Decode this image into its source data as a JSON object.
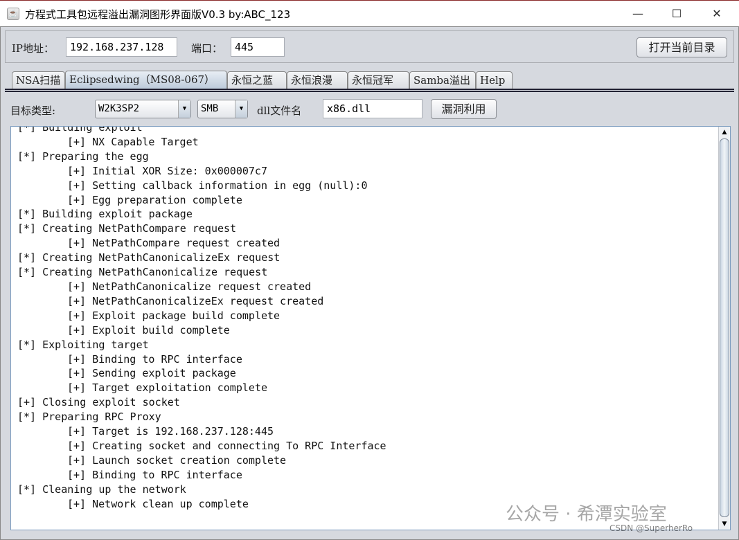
{
  "window": {
    "title": "方程式工具包远程溢出漏洞图形界面版V0.3 by:ABC_123",
    "minimize": "—",
    "maximize": "☐",
    "close": "✕"
  },
  "connection": {
    "ip_label": "IP地址：",
    "ip_value": "192.168.237.128",
    "port_label": "端口：",
    "port_value": "445",
    "open_dir_button": "打开当前目录"
  },
  "tabs": [
    {
      "label": "NSA扫描"
    },
    {
      "label": "Eclipsedwing（MS08-067）",
      "active": true
    },
    {
      "label": "永恒之蓝"
    },
    {
      "label": "永恒浪漫"
    },
    {
      "label": "永恒冠军"
    },
    {
      "label": "Samba溢出"
    },
    {
      "label": "Help"
    }
  ],
  "options": {
    "target_label": "目标类型:",
    "target_value": "W2K3SP2",
    "protocol_value": "SMB",
    "dll_label": "dll文件名",
    "dll_value": "x86.dll",
    "exploit_button": "漏洞利用"
  },
  "log": [
    "[*] Building exploit",
    "\t[+] NX Capable Target",
    "[*] Preparing the egg",
    "\t[+] Initial XOR Size: 0x000007c7",
    "\t[+] Setting callback information in egg (null):0",
    "\t[+] Egg preparation complete",
    "[*] Building exploit package",
    "[*] Creating NetPathCompare request",
    "\t[+] NetPathCompare request created",
    "[*] Creating NetPathCanonicalizeEx request",
    "[*] Creating NetPathCanonicalize request",
    "\t[+] NetPathCanonicalize request created",
    "\t[+] NetPathCanonicalizeEx request created",
    "\t[+] Exploit package build complete",
    "\t[+] Exploit build complete",
    "[*] Exploiting target",
    "\t[+] Binding to RPC interface",
    "\t[+] Sending exploit package",
    "\t[+] Target exploitation complete",
    "[+] Closing exploit socket",
    "[*] Preparing RPC Proxy",
    "\t[+] Target is 192.168.237.128:445",
    "\t[+] Creating socket and connecting To RPC Interface",
    "\t[+] Launch socket creation complete",
    "\t[+] Binding to RPC interface",
    "[*] Cleaning up the network",
    "\t[+] Network clean up complete"
  ],
  "watermark": {
    "account": "公众号 · 希潭实验室",
    "csdn": "CSDN @SuperherRo"
  }
}
